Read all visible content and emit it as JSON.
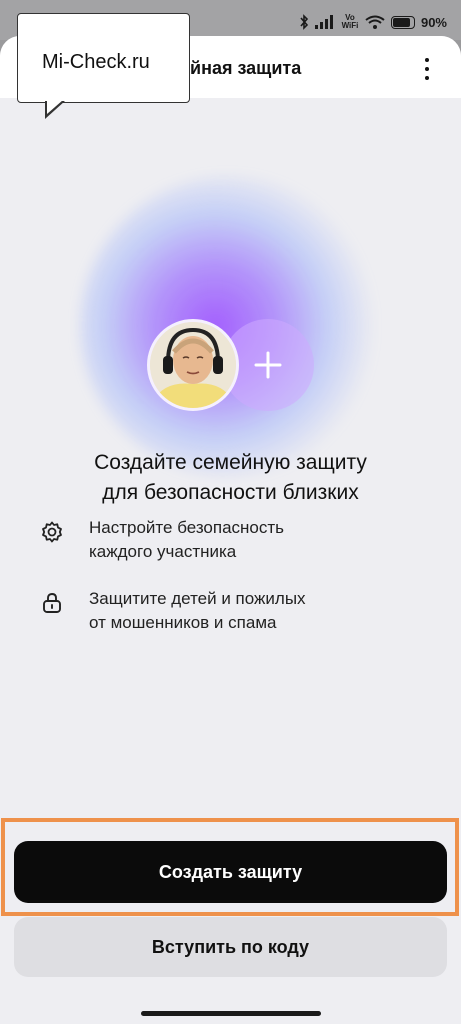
{
  "status_bar": {
    "battery": "90%",
    "signal_label": "Vo WiFi",
    "icons": [
      "bluetooth-icon",
      "signal-icon",
      "vowifi-icon",
      "wifi-icon",
      "battery-icon"
    ]
  },
  "watermark": {
    "text": "Mi-Check.ru"
  },
  "header": {
    "title": "Семейная защита",
    "title_visible": "ейная защита",
    "menu_icon": "more-vertical-icon"
  },
  "hero": {
    "headline_line1": "Создайте семейную защиту",
    "headline_line2": "для безопасности близких",
    "add_icon": "plus-icon"
  },
  "features": [
    {
      "icon": "gear-icon",
      "line1": "Настройте безопасность",
      "line2": "каждого участника"
    },
    {
      "icon": "lock-icon",
      "line1": "Защитите детей и пожилых",
      "line2": "от мошенников и спама"
    }
  ],
  "actions": {
    "primary_label": "Создать защиту",
    "secondary_label": "Вступить по коду"
  },
  "colors": {
    "accent_highlight": "#ee914b",
    "primary_button": "#0b0b0b",
    "glow": "#9646ff"
  }
}
